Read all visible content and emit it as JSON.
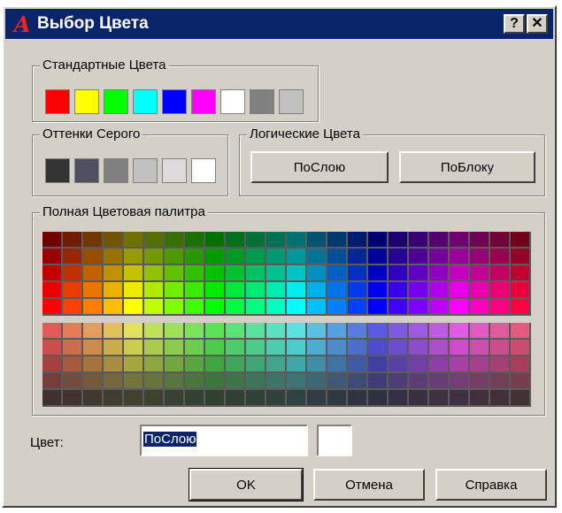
{
  "window": {
    "title": "Выбор Цвета",
    "help_label": "?",
    "close_label": "✕"
  },
  "standard": {
    "label": "Стандартные Цвета",
    "colors": [
      "#ff0000",
      "#ffff00",
      "#00ff00",
      "#00ffff",
      "#0000ff",
      "#ff00ff",
      "#ffffff",
      "#808080",
      "#c0c0c0"
    ]
  },
  "gray": {
    "label": "Оттенки Серого",
    "colors": [
      "#333333",
      "#505060",
      "#808080",
      "#c0c0c0",
      "#dcdcdc",
      "#ffffff"
    ]
  },
  "logical": {
    "label": "Логические Цвета",
    "bylayer_label": "ПоСлою",
    "byblock_label": "ПоБлоку"
  },
  "palette": {
    "label": "Полная Цветовая палитра"
  },
  "color_field": {
    "label": "Цвет:",
    "value": "ПоСлою",
    "preview": "#ffffff"
  },
  "buttons": {
    "ok_label": "OK",
    "cancel_label": "Отмена",
    "help_label": "Справка"
  }
}
